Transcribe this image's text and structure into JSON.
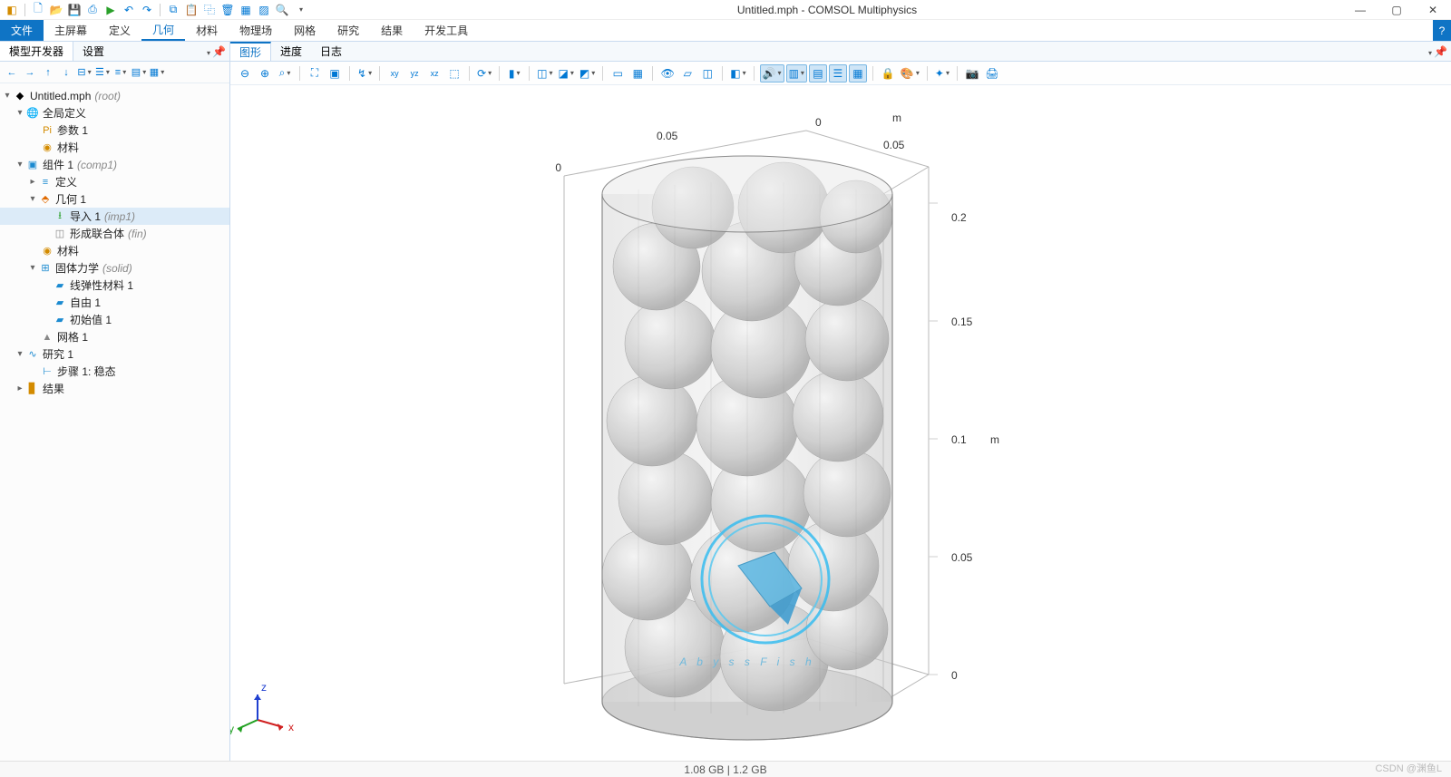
{
  "app": {
    "title": "Untitled.mph - COMSOL Multiphysics"
  },
  "menubar": {
    "file": "文件",
    "items": [
      "主屏幕",
      "定义",
      "几何",
      "材料",
      "物理场",
      "网格",
      "研究",
      "结果",
      "开发工具"
    ],
    "activeIndex": 2
  },
  "leftpanel": {
    "tabs": {
      "builder": "模型开发器",
      "settings": "设置"
    }
  },
  "tree": {
    "root": {
      "label": "Untitled.mph",
      "tag": "(root)"
    },
    "global": {
      "label": "全局定义"
    },
    "params": {
      "label": "参数 1"
    },
    "gmat": {
      "label": "材料"
    },
    "comp": {
      "label": "组件 1",
      "tag": "(comp1)"
    },
    "def": {
      "label": "定义"
    },
    "geom": {
      "label": "几何 1"
    },
    "imp": {
      "label": "导入 1",
      "tag": "(imp1)"
    },
    "fin": {
      "label": "形成联合体",
      "tag": "(fin)"
    },
    "cmat": {
      "label": "材料"
    },
    "solid": {
      "label": "固体力学",
      "tag": "(solid)"
    },
    "lemat": {
      "label": "线弹性材料 1"
    },
    "free": {
      "label": "自由 1"
    },
    "init": {
      "label": "初始值 1"
    },
    "mesh": {
      "label": "网格 1"
    },
    "study": {
      "label": "研究 1"
    },
    "step": {
      "label": "步骤 1: 稳态"
    },
    "results": {
      "label": "结果"
    }
  },
  "graphics": {
    "tabs": {
      "graphics": "图形",
      "progress": "进度",
      "log": "日志"
    },
    "axis": {
      "unit": "m",
      "x_ticks": [
        "0",
        "0.05"
      ],
      "y_ticks": [
        "0",
        "0.05"
      ],
      "z_ticks": [
        "0",
        "0.05",
        "0.1",
        "0.15",
        "0.2"
      ]
    },
    "triad": {
      "x": "x",
      "y": "y",
      "z": "z"
    },
    "watermark": "A b y s s F i s h"
  },
  "status": {
    "memory": "1.08 GB | 1.2 GB"
  },
  "attribution": "CSDN @渊鱼L"
}
